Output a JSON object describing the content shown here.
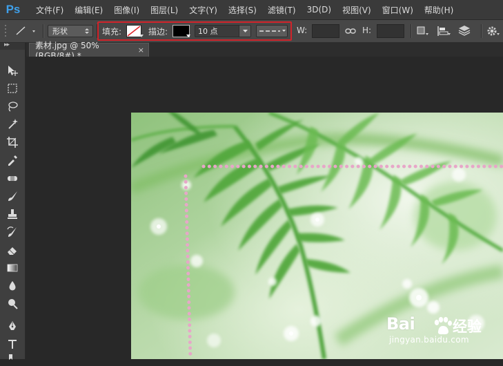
{
  "app": {
    "logo": "Ps"
  },
  "menu": [
    "文件(F)",
    "编辑(E)",
    "图像(I)",
    "图层(L)",
    "文字(Y)",
    "选择(S)",
    "滤镜(T)",
    "3D(D)",
    "视图(V)",
    "窗口(W)",
    "帮助(H)"
  ],
  "options": {
    "mode_value": "形状",
    "fill_label": "填充:",
    "stroke_label": "描边:",
    "stroke_color": "#000000",
    "stroke_width": "10 点",
    "width_label": "W:",
    "height_label": "H:"
  },
  "document": {
    "tab_title": "素材.jpg @ 50%(RGB/8#) *",
    "close_glyph": "×"
  },
  "colors": {
    "accent_blue": "#3fa0ea",
    "highlight_red": "#d2232a",
    "dotted_path_pink": "#e7a7c8"
  },
  "watermark": {
    "brand": "Bai",
    "brand_suffix": "经验",
    "url": "jingyan.baidu.com"
  }
}
